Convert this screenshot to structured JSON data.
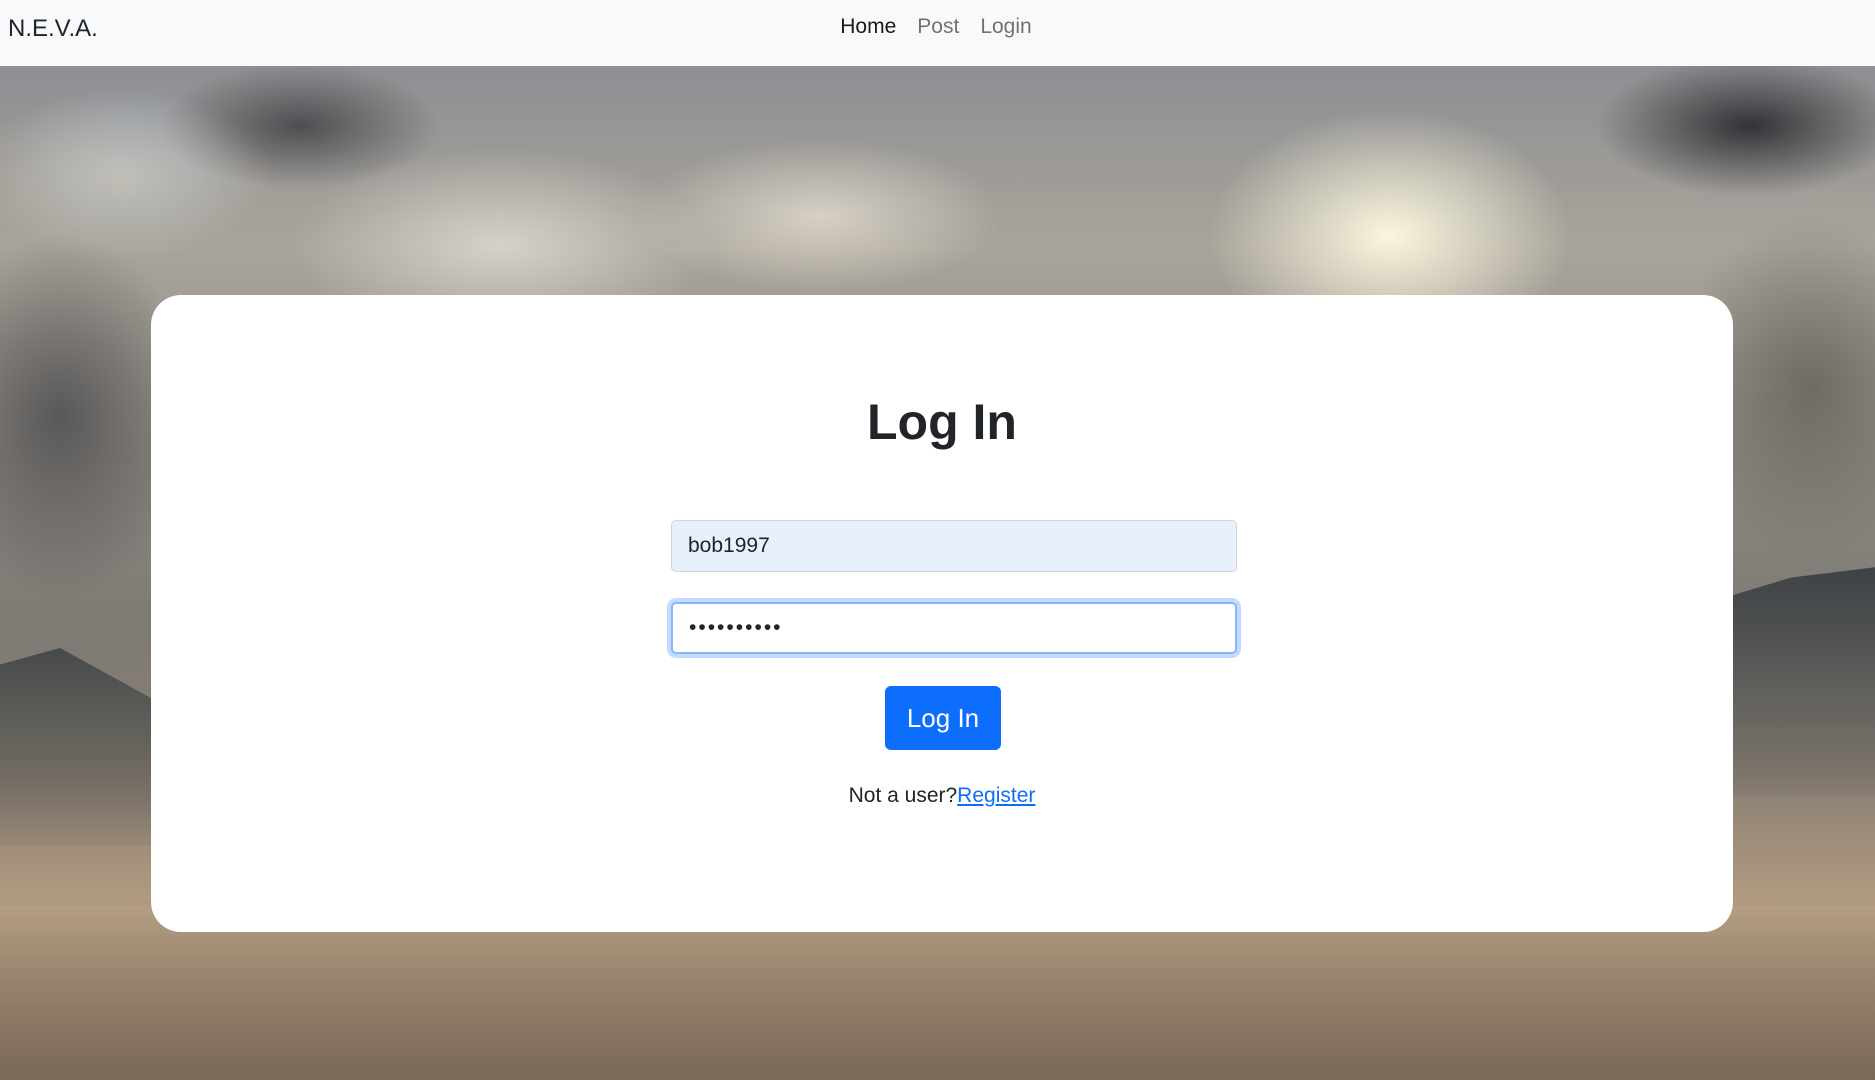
{
  "navbar": {
    "brand": "N.E.V.A.",
    "links": [
      {
        "label": "Home",
        "active": true
      },
      {
        "label": "Post",
        "active": false
      },
      {
        "label": "Login",
        "active": false
      }
    ]
  },
  "login": {
    "title": "Log In",
    "username_value": "bob1997",
    "password_value": "••••••••••",
    "submit_label": "Log In",
    "register_prompt": "Not a user?",
    "register_link": "Register"
  },
  "colors": {
    "primary": "#0d6efd",
    "navbar_bg": "#f8f9fa",
    "autofill_bg": "#e8f0fe",
    "focus_border": "#86b7fe"
  }
}
